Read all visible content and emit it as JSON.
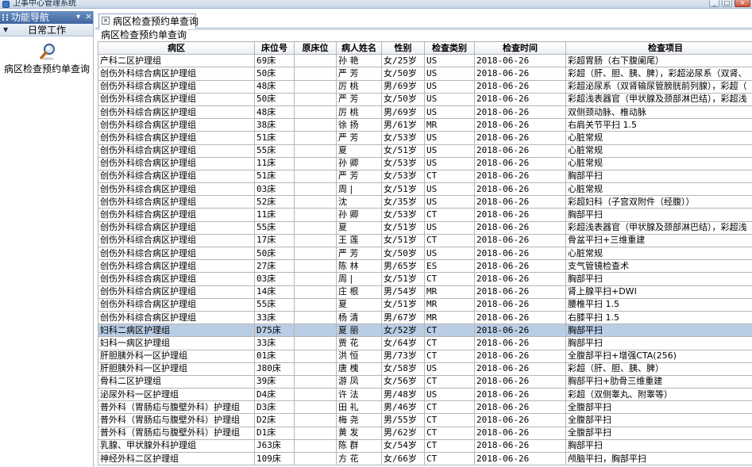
{
  "window": {
    "title": "卫事中心管理系统",
    "minimize_label": "_",
    "maximize_label": "□",
    "close_label": "×"
  },
  "nav": {
    "title": "功能导航",
    "pin_label": "▾",
    "close_label": "×",
    "group_arrow": "▼",
    "group_label": "日常工作",
    "items": [
      {
        "label": "病区检查预约单查询",
        "icon": "magnifier-icon"
      }
    ]
  },
  "tabs": [
    {
      "label": "病区检查预约单查询",
      "close_label": "×"
    }
  ],
  "groupbox_title": "病区检查预约单查询",
  "table": {
    "columns": [
      "病区",
      "床位号",
      "原床位",
      "病人姓名",
      "性别",
      "检查类别",
      "检查时间",
      "检查项目"
    ],
    "selected_row": 21,
    "rows": [
      [
        "产科二区护理组",
        "69床",
        "",
        "孙 艳",
        "女/25岁",
        "US",
        "2018-06-26",
        "彩超胃肠（右下腹阑尾）"
      ],
      [
        "创伤外科综合病区护理组",
        "50床",
        "",
        "严 芳",
        "女/50岁",
        "US",
        "2018-06-26",
        "彩超（肝、胆、胰、脾），彩超泌尿系（双肾、"
      ],
      [
        "创伤外科综合病区护理组",
        "48床",
        "",
        "厉 桃",
        "男/69岁",
        "US",
        "2018-06-26",
        "彩超泌尿系（双肾输尿管膀胱前列腺），彩超（"
      ],
      [
        "创伤外科综合病区护理组",
        "50床",
        "",
        "严 芳",
        "女/50岁",
        "US",
        "2018-06-26",
        "彩超浅表器官（甲状腺及颈部淋巴结），彩超浅"
      ],
      [
        "创伤外科综合病区护理组",
        "48床",
        "",
        "厉 桃",
        "男/69岁",
        "US",
        "2018-06-26",
        "双侧颈动脉、椎动脉"
      ],
      [
        "创伤外科综合病区护理组",
        "38床",
        "",
        "徐 扬",
        "男/61岁",
        "MR",
        "2018-06-26",
        "右肩关节平扫 1.5"
      ],
      [
        "创伤外科综合病区护理组",
        "51床",
        "",
        "严 芳",
        "女/53岁",
        "US",
        "2018-06-26",
        "心脏常规"
      ],
      [
        "创伤外科综合病区护理组",
        "55床",
        "",
        "夏",
        "女/51岁",
        "US",
        "2018-06-26",
        "心脏常规"
      ],
      [
        "创伤外科综合病区护理组",
        "11床",
        "",
        "孙 卿",
        "女/53岁",
        "US",
        "2018-06-26",
        "心脏常规"
      ],
      [
        "创伤外科综合病区护理组",
        "51床",
        "",
        "严 芳",
        "女/53岁",
        "CT",
        "2018-06-26",
        "胸部平扫"
      ],
      [
        "创伤外科综合病区护理组",
        "03床",
        "",
        "周 |",
        "女/51岁",
        "US",
        "2018-06-26",
        "心脏常规"
      ],
      [
        "创伤外科综合病区护理组",
        "52床",
        "",
        "沈",
        "女/35岁",
        "US",
        "2018-06-26",
        "彩超妇科（子宫双附件（经腹））"
      ],
      [
        "创伤外科综合病区护理组",
        "11床",
        "",
        "孙 卿",
        "女/53岁",
        "CT",
        "2018-06-26",
        "胸部平扫"
      ],
      [
        "创伤外科综合病区护理组",
        "55床",
        "",
        "夏",
        "女/51岁",
        "US",
        "2018-06-26",
        "彩超浅表器官（甲状腺及颈部淋巴结），彩超浅"
      ],
      [
        "创伤外科综合病区护理组",
        "17床",
        "",
        "王 莲",
        "女/51岁",
        "CT",
        "2018-06-26",
        "骨盆平扫+三维重建"
      ],
      [
        "创伤外科综合病区护理组",
        "50床",
        "",
        "严 芳",
        "女/50岁",
        "US",
        "2018-06-26",
        "心脏常规"
      ],
      [
        "创伤外科综合病区护理组",
        "27床",
        "",
        "陈 林",
        "男/65岁",
        "ES",
        "2018-06-26",
        "支气管镜检查术"
      ],
      [
        "创伤外科综合病区护理组",
        "03床",
        "",
        "周 |",
        "女/51岁",
        "CT",
        "2018-06-26",
        "胸部平扫"
      ],
      [
        "创伤外科综合病区护理组",
        "14床",
        "",
        "庄 根",
        "男/54岁",
        "MR",
        "2018-06-26",
        "肾上腺平扫+DWI"
      ],
      [
        "创伤外科综合病区护理组",
        "55床",
        "",
        "夏",
        "女/51岁",
        "MR",
        "2018-06-26",
        "腰椎平扫 1.5"
      ],
      [
        "创伤外科综合病区护理组",
        "33床",
        "",
        "杨 清",
        "男/67岁",
        "MR",
        "2018-06-26",
        "右膝平扫 1.5"
      ],
      [
        "妇科二病区护理组",
        "D75床",
        "",
        "夏 丽",
        "女/52岁",
        "CT",
        "2018-06-26",
        "胸部平扫"
      ],
      [
        "妇科一病区护理组",
        "33床",
        "",
        "贾 花",
        "女/64岁",
        "CT",
        "2018-06-26",
        "胸部平扫"
      ],
      [
        "肝胆胰外科一区护理组",
        "01床",
        "",
        "洪 恒",
        "男/73岁",
        "CT",
        "2018-06-26",
        "全腹部平扫+增强CTA(256)"
      ],
      [
        "肝胆胰外科一区护理组",
        "J80床",
        "",
        "唐 槐",
        "女/58岁",
        "US",
        "2018-06-26",
        "彩超（肝、胆、胰、脾）"
      ],
      [
        "骨科二区护理组",
        "39床",
        "",
        "游 凤",
        "女/56岁",
        "CT",
        "2018-06-26",
        "胸部平扫+肋骨三维重建"
      ],
      [
        "泌尿外科一区护理组",
        "D4床",
        "",
        "许 法",
        "男/48岁",
        "US",
        "2018-06-26",
        "彩超（双侧睾丸、附睾等）"
      ],
      [
        "普外科（胃肠疝与腹壁外科）护理组",
        "D3床",
        "",
        "田 礼",
        "男/46岁",
        "CT",
        "2018-06-26",
        "全腹部平扫"
      ],
      [
        "普外科（胃肠疝与腹壁外科）护理组",
        "D2床",
        "",
        "梅 尧",
        "男/55岁",
        "CT",
        "2018-06-26",
        "全腹部平扫"
      ],
      [
        "普外科（胃肠疝与腹壁外科）护理组",
        "D1床",
        "",
        "黄 发",
        "男/62岁",
        "CT",
        "2018-06-26",
        "全腹部平扫"
      ],
      [
        "乳腺、甲状腺外科护理组",
        "J63床",
        "",
        "陈 群",
        "女/54岁",
        "CT",
        "2018-06-26",
        "胸部平扫"
      ],
      [
        "神经外科二区护理组",
        "109床",
        "",
        "方 花",
        "女/66岁",
        "CT",
        "2018-06-26",
        "颅脑平扫，胸部平扫"
      ]
    ]
  }
}
